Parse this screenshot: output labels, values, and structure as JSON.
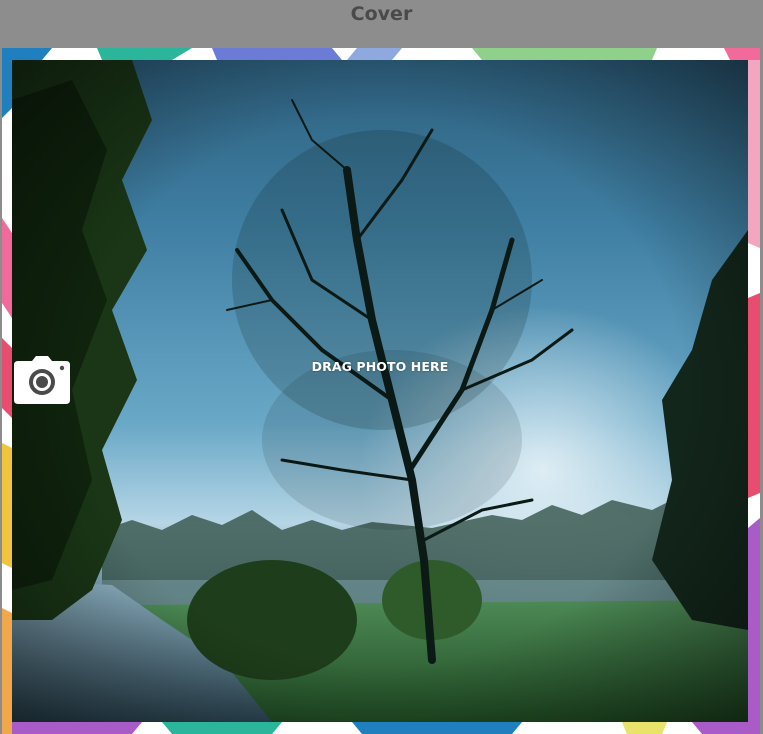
{
  "header": {
    "title": "Cover"
  },
  "photo_slot": {
    "hint_label": "DRAG PHOTO HERE",
    "icon": "camera-icon",
    "image_description_colors": {
      "sky": "#5f98b6",
      "foliage": "#1e3d1a",
      "grass": "#3e7a35",
      "water": "#6f94a8"
    }
  },
  "frame": {
    "background": "#ffffff",
    "pattern_colors": [
      "#1f7fbf",
      "#2bb59a",
      "#6c7bd6",
      "#8fd18a",
      "#f16a9a",
      "#e8e36b",
      "#a95cc8",
      "#e84c6e",
      "#f0c43c"
    ]
  }
}
